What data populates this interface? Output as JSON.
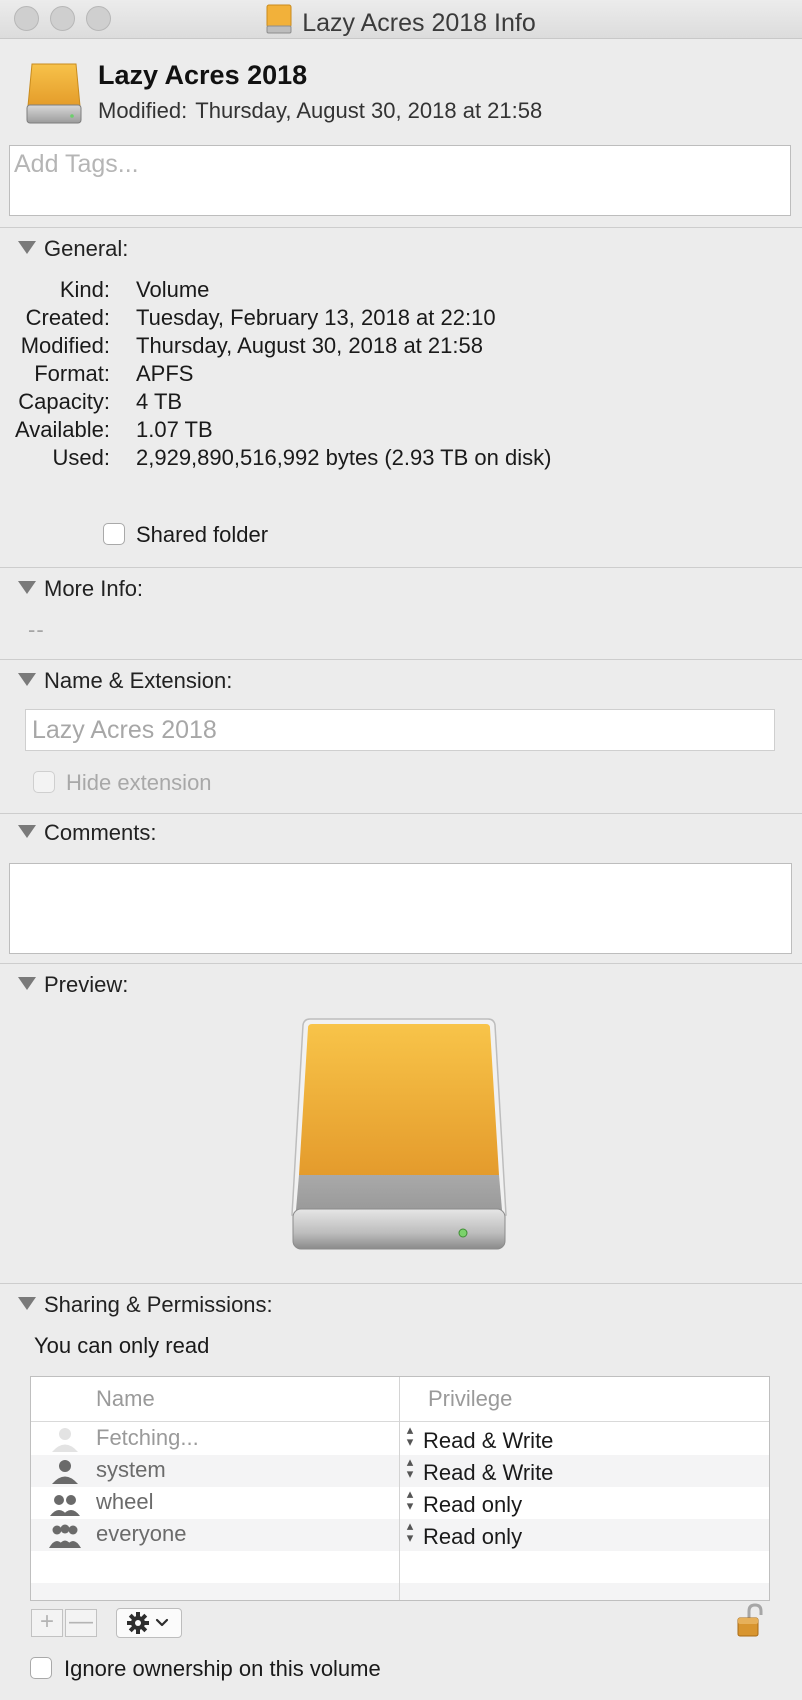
{
  "window": {
    "title": "Lazy Acres 2018 Info"
  },
  "header": {
    "name": "Lazy Acres 2018",
    "modified_label": "Modified:",
    "modified_value": "Thursday, August 30, 2018 at 21:58"
  },
  "tags": {
    "placeholder": "Add Tags..."
  },
  "general": {
    "heading": "General:",
    "rows": [
      {
        "label": "Kind:",
        "value": "Volume"
      },
      {
        "label": "Created:",
        "value": "Tuesday, February 13, 2018 at 22:10"
      },
      {
        "label": "Modified:",
        "value": "Thursday, August 30, 2018 at 21:58"
      },
      {
        "label": "Format:",
        "value": "APFS"
      },
      {
        "label": "Capacity:",
        "value": "4 TB"
      },
      {
        "label": "Available:",
        "value": "1.07 TB"
      },
      {
        "label": "Used:",
        "value": "2,929,890,516,992 bytes (2.93 TB on disk)"
      }
    ],
    "shared_folder_label": "Shared folder"
  },
  "more_info": {
    "heading": "More Info:",
    "value": "--"
  },
  "name_extension": {
    "heading": "Name & Extension:",
    "name_value": "Lazy Acres 2018",
    "hide_extension_label": "Hide extension"
  },
  "comments": {
    "heading": "Comments:",
    "value": ""
  },
  "preview": {
    "heading": "Preview:"
  },
  "sharing": {
    "heading": "Sharing & Permissions:",
    "status": "You can only read",
    "columns": {
      "name": "Name",
      "privilege": "Privilege"
    },
    "rows": [
      {
        "name": "Fetching...",
        "privilege": "Read & Write",
        "icon": "user-faded-icon"
      },
      {
        "name": "system",
        "privilege": "Read & Write",
        "icon": "user-icon"
      },
      {
        "name": "wheel",
        "privilege": "Read only",
        "icon": "group-icon"
      },
      {
        "name": "everyone",
        "privilege": "Read only",
        "icon": "everyone-icon"
      }
    ],
    "ignore_ownership_label": "Ignore ownership on this volume",
    "add_symbol": "+",
    "remove_symbol": "—"
  },
  "colors": {
    "drive_orange": "#f2b13a",
    "window_bg": "#ececec"
  }
}
